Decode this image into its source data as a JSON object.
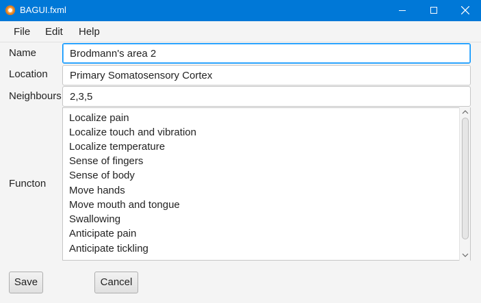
{
  "window": {
    "title": "BAGUI.fxml",
    "app_icon": "app-icon"
  },
  "menubar": {
    "items": [
      "File",
      "Edit",
      "Help"
    ]
  },
  "form": {
    "name_label": "Name",
    "name_value": "Brodmann's area 2",
    "location_label": "Location",
    "location_value": "Primary Somatosensory Cortex",
    "neighbours_label": "Neighbours",
    "neighbours_value": "2,3,5",
    "function_label": "Functon",
    "function_items": [
      "Localize pain",
      "Localize touch and vibration",
      "Localize temperature",
      "Sense of fingers",
      "Sense of body",
      "Move hands",
      "Move mouth and tongue",
      "Swallowing",
      "Anticipate pain",
      "Anticipate tickling"
    ]
  },
  "buttons": {
    "save": "Save",
    "cancel": "Cancel"
  },
  "colors": {
    "titlebar": "#0078d7",
    "focus_border": "#0093ff"
  }
}
